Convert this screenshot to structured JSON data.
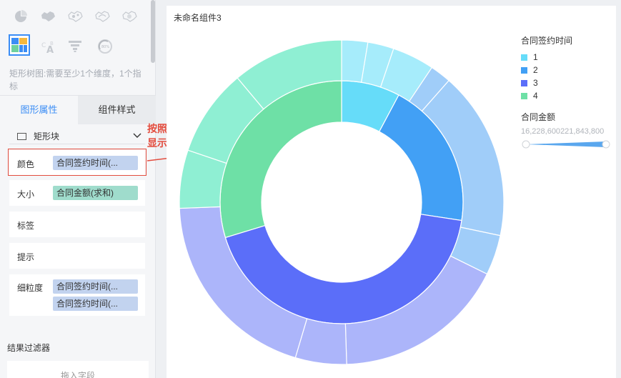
{
  "hint": "矩形树图:需要至少1个维度，1个指标",
  "tabs": {
    "attr": "图形属性",
    "style": "组件样式"
  },
  "mark": {
    "label": "矩形块"
  },
  "props": {
    "color": {
      "label": "颜色",
      "field": "合同签约时间(..."
    },
    "size": {
      "label": "大小",
      "field": "合同金额(求和)"
    },
    "label": {
      "label": "标签"
    },
    "tooltip": {
      "label": "提示"
    },
    "granularity": {
      "label": "细粒度",
      "fields": [
        "合同签约时间(...",
        "合同签约时间(..."
      ]
    }
  },
  "filter": {
    "title": "结果过滤器",
    "drop_hint": "拖入字段"
  },
  "annotation": {
    "line1": "按照季度",
    "line2": "显示颜色"
  },
  "component": {
    "title": "未命名组件3"
  },
  "legend": {
    "title": "合同签约时间",
    "items": [
      {
        "label": "1",
        "color": "#66dcf9"
      },
      {
        "label": "2",
        "color": "#42a0f5"
      },
      {
        "label": "3",
        "color": "#5b6ef9"
      },
      {
        "label": "4",
        "color": "#6ee0a6"
      }
    ]
  },
  "size_legend": {
    "title": "合同金额",
    "min": "16,228,600",
    "max": "221,843,800"
  },
  "colors": {
    "accent": "#3b8df5",
    "annotation": "#e34d3f"
  },
  "chart_data": {
    "type": "sunburst",
    "inner_ring": [
      {
        "name": "1",
        "value": 0.078,
        "color": "#66dcf9"
      },
      {
        "name": "2",
        "value": 0.196,
        "color": "#42a0f5"
      },
      {
        "name": "3",
        "value": 0.429,
        "color": "#5b6ef9"
      },
      {
        "name": "4",
        "value": 0.297,
        "color": "#6ee0a6"
      }
    ],
    "outer_ring": [
      {
        "quarter": "1",
        "value": 0.026,
        "color": "#a6ecfb"
      },
      {
        "quarter": "1",
        "value": 0.026,
        "color": "#a6ecfb"
      },
      {
        "quarter": "1",
        "value": 0.042,
        "color": "#a6ecfb"
      },
      {
        "quarter": "2",
        "value": 0.021,
        "color": "#a0cdf9"
      },
      {
        "quarter": "2",
        "value": 0.168,
        "color": "#a0cdf9"
      },
      {
        "quarter": "2",
        "value": 0.04,
        "color": "#a0cdf9"
      },
      {
        "quarter": "3",
        "value": 0.172,
        "color": "#acb5fa"
      },
      {
        "quarter": "3",
        "value": 0.051,
        "color": "#acb5fa"
      },
      {
        "quarter": "3",
        "value": 0.198,
        "color": "#acb5fa"
      },
      {
        "quarter": "4",
        "value": 0.058,
        "color": "#8fefd3"
      },
      {
        "quarter": "4",
        "value": 0.087,
        "color": "#8fefd3"
      },
      {
        "quarter": "4",
        "value": 0.111,
        "color": "#8fefd3"
      }
    ]
  }
}
